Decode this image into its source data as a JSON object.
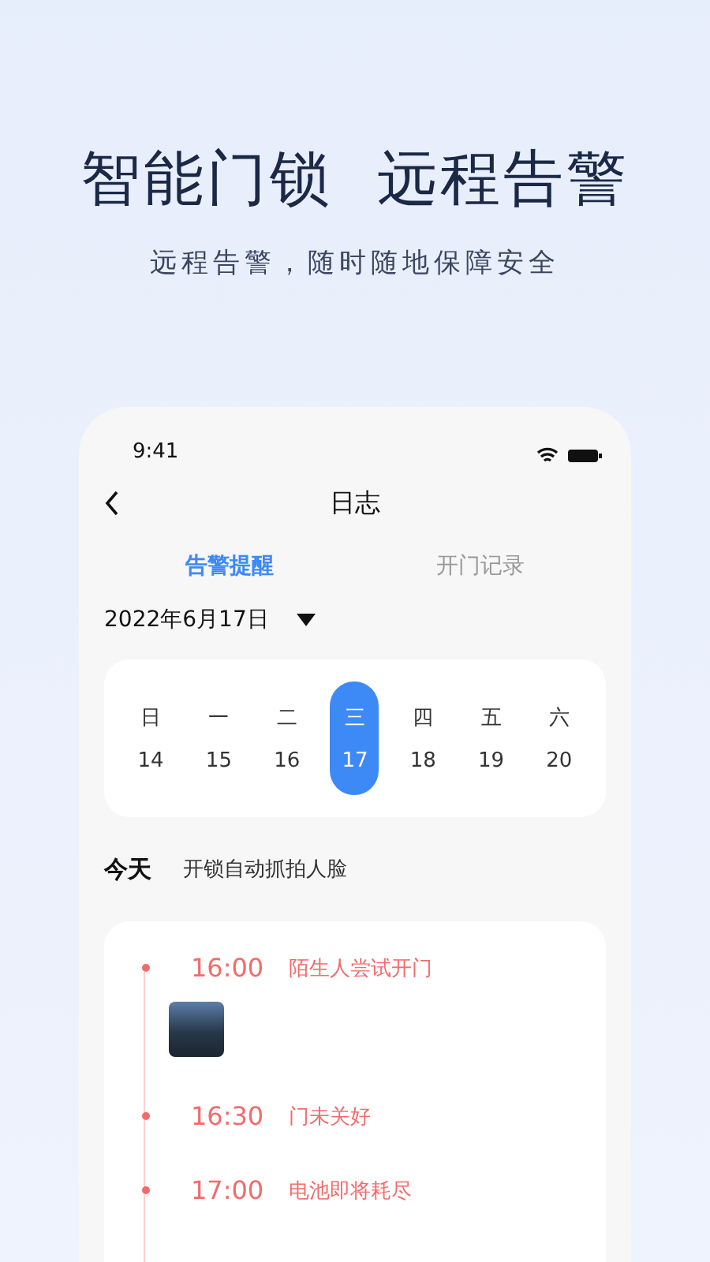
{
  "headline": {
    "title": "智能门锁  远程告警",
    "subtitle": "远程告警，随时随地保障安全"
  },
  "status_bar": {
    "time": "9:41"
  },
  "nav": {
    "title": "日志"
  },
  "tabs": [
    {
      "label": "告警提醒",
      "selected": true
    },
    {
      "label": "开门记录",
      "selected": false
    }
  ],
  "date_picker": {
    "value": "2022年6月17日"
  },
  "week": [
    {
      "weekday": "日",
      "day": "14",
      "selected": false
    },
    {
      "weekday": "一",
      "day": "15",
      "selected": false
    },
    {
      "weekday": "二",
      "day": "16",
      "selected": false
    },
    {
      "weekday": "三",
      "day": "17",
      "selected": true
    },
    {
      "weekday": "四",
      "day": "18",
      "selected": false
    },
    {
      "weekday": "五",
      "day": "19",
      "selected": false
    },
    {
      "weekday": "六",
      "day": "20",
      "selected": false
    }
  ],
  "today": {
    "label": "今天",
    "note": "开锁自动抓拍人脸"
  },
  "events": [
    {
      "time": "16:00",
      "text": "陌生人尝试开门",
      "has_photo": true
    },
    {
      "time": "16:30",
      "text": "门未关好",
      "has_photo": false
    },
    {
      "time": "17:00",
      "text": "电池即将耗尽",
      "has_photo": false
    }
  ]
}
